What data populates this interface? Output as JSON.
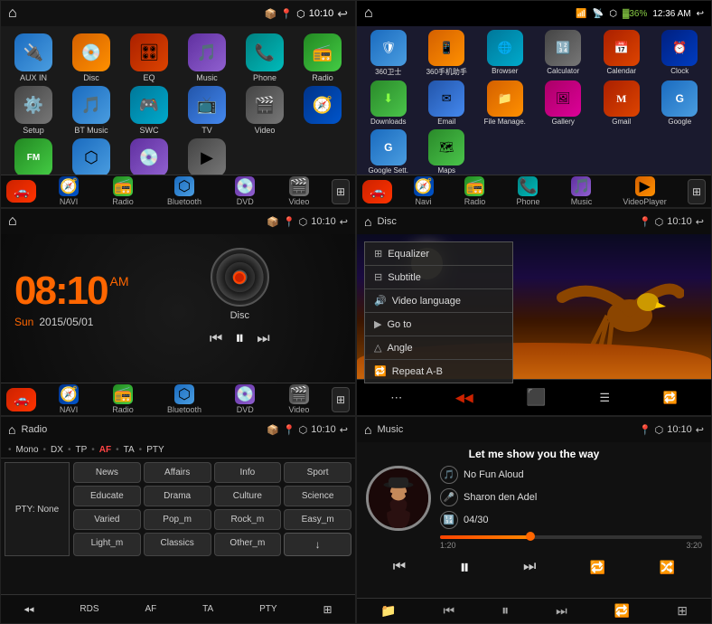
{
  "panels": {
    "p1": {
      "title": "",
      "time": "10:10",
      "apps": [
        {
          "label": "AUX IN",
          "color": "ic-blue",
          "icon": "🔌"
        },
        {
          "label": "Disc",
          "color": "ic-orange",
          "icon": "💿"
        },
        {
          "label": "EQ",
          "color": "ic-red",
          "icon": "🎛"
        },
        {
          "label": "Music",
          "color": "ic-purple",
          "icon": "🎵"
        },
        {
          "label": "Phone",
          "color": "ic-teal",
          "icon": "📞"
        },
        {
          "label": "Radio",
          "color": "ic-fmgreen",
          "icon": "📻"
        },
        {
          "label": "Setup",
          "color": "ic-grey",
          "icon": "⚙️"
        },
        {
          "label": "BT Music",
          "color": "ic-blue",
          "icon": "🎵"
        },
        {
          "label": "SWC",
          "color": "ic-cyan",
          "icon": "🎮"
        },
        {
          "label": "TV",
          "color": "ic-lightblue",
          "icon": "📺"
        },
        {
          "label": "Video",
          "color": "ic-grey",
          "icon": "🎬"
        }
      ],
      "nav": [
        "NAVI",
        "Radio",
        "Bluetooth",
        "DVD",
        "Video"
      ]
    },
    "p2": {
      "time": "12:36 AM",
      "apps": [
        {
          "label": "360卫士",
          "color": "ic-blue",
          "icon": "🛡"
        },
        {
          "label": "360手机助手",
          "color": "ic-orange",
          "icon": "📱"
        },
        {
          "label": "Browser",
          "color": "ic-blue",
          "icon": "🌐"
        },
        {
          "label": "Calculator",
          "color": "ic-grey",
          "icon": "🔢"
        },
        {
          "label": "Calendar",
          "color": "ic-red",
          "icon": "📅"
        },
        {
          "label": "Clock",
          "color": "ic-darkblue",
          "icon": "⏰"
        },
        {
          "label": "Downloads",
          "color": "ic-green",
          "icon": "⬇"
        },
        {
          "label": "Email",
          "color": "ic-blue",
          "icon": "✉"
        },
        {
          "label": "File Manage.",
          "color": "ic-orange",
          "icon": "📁"
        },
        {
          "label": "Gallery",
          "color": "ic-pink",
          "icon": "🖼"
        },
        {
          "label": "Gmail",
          "color": "ic-red",
          "icon": "M"
        },
        {
          "label": "Google",
          "color": "ic-blue",
          "icon": "G"
        },
        {
          "label": "Google Sett.",
          "color": "ic-blue",
          "icon": "G"
        },
        {
          "label": "Maps",
          "color": "ic-green",
          "icon": "🗺"
        },
        {
          "label": "Navi",
          "color": "ic-navblue",
          "icon": "🧭"
        },
        {
          "label": "Radio",
          "color": "ic-fmgreen",
          "icon": "📻"
        },
        {
          "label": "Phone",
          "color": "ic-teal",
          "icon": "📞"
        },
        {
          "label": "Music",
          "color": "ic-purple",
          "icon": "🎵"
        },
        {
          "label": "VideoPlayer",
          "color": "ic-orange",
          "icon": "▶"
        }
      ],
      "nav": [
        "Navi",
        "Radio",
        "Phone",
        "Music",
        "VideoPlayer"
      ]
    },
    "p3": {
      "time": "10:10",
      "clock": {
        "hour": "08:10",
        "ampm": "AM",
        "day": "Sun",
        "date": "2015/05/01"
      },
      "disc_label": "Disc",
      "nav": [
        "NAVI",
        "Radio",
        "Bluetooth",
        "DVD",
        "Video"
      ]
    },
    "p4": {
      "title": "Disc",
      "time": "10:10",
      "menu_items": [
        {
          "label": "Equalizer",
          "icon": "⊞"
        },
        {
          "label": "Subtitle",
          "icon": "⊟"
        },
        {
          "label": "Video language",
          "icon": "🔊"
        },
        {
          "label": "Go to",
          "icon": "▶"
        },
        {
          "label": "Angle",
          "icon": "△"
        },
        {
          "label": "Repeat A-B",
          "icon": "🔁"
        }
      ]
    },
    "p5": {
      "title": "Radio",
      "time": "10:10",
      "info_bar": [
        "Mono",
        "DX",
        "TP",
        "AF",
        "TA",
        "PTY"
      ],
      "active_item": "AF",
      "pty_label": "PTY:",
      "pty_value": "None",
      "buttons": [
        "News",
        "Affairs",
        "Info",
        "Sport",
        "Educate",
        "Drama",
        "Culture",
        "Science",
        "Varied",
        "Pop_m",
        "Rock_m",
        "Easy_m",
        "Light_m",
        "Classics",
        "Other_m",
        "↓"
      ],
      "bottom_items": [
        "RDS",
        "AF",
        "TA",
        "PTY",
        "⊞"
      ]
    },
    "p6": {
      "title": "Music",
      "time": "10:10",
      "song_title": "Let me show you the way",
      "artist1": "No Fun Aloud",
      "artist2": "Sharon den Adel",
      "track_num": "04/30",
      "time_current": "1:20",
      "time_total": "3:20",
      "progress_pct": 35
    }
  }
}
